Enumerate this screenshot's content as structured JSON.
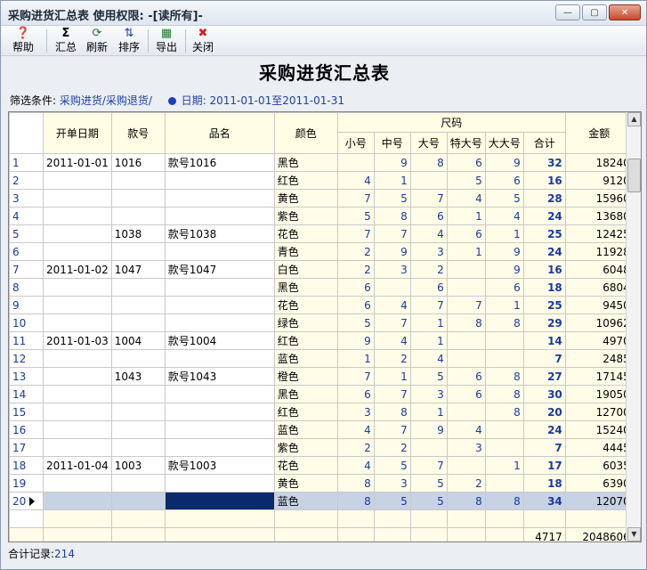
{
  "window": {
    "title": "采购进货汇总表  使用权限: -[读所有]-",
    "controls": {
      "minimize": "—",
      "restore": "▢",
      "close": "✕"
    }
  },
  "toolbar": {
    "items": [
      {
        "label": "帮助",
        "icon": "help-icon",
        "glyph": "❓"
      },
      {
        "label": "汇总",
        "icon": "sigma-icon",
        "glyph": "Σ"
      },
      {
        "label": "刷新",
        "icon": "refresh-icon",
        "glyph": "⟳"
      },
      {
        "label": "排序",
        "icon": "sort-icon",
        "glyph": "⇅"
      },
      {
        "label": "导出",
        "icon": "excel-export-icon",
        "glyph": "▦"
      },
      {
        "label": "关闭",
        "icon": "close-red-icon",
        "glyph": "✖"
      }
    ]
  },
  "report": {
    "title": "采购进货汇总表"
  },
  "filter": {
    "label": "筛选条件:",
    "value": "采购进货/采购退货/",
    "date_label": "日期:",
    "date_value": "2011-01-01至2011-01-31"
  },
  "grid": {
    "headers": {
      "order_date": "开单日期",
      "style_no": "款号",
      "product_name": "品名",
      "color": "颜色",
      "size_group": "尺码",
      "sizes": [
        "小号",
        "中号",
        "大号",
        "特大号",
        "大大号",
        "合计"
      ],
      "amount": "金额"
    },
    "rows": [
      {
        "n": "1",
        "date": "2011-01-01",
        "style": "1016",
        "name": "款号1016",
        "color": "黑色",
        "s": "",
        "m": "9",
        "l": "8",
        "xl": "6",
        "xxl": "9",
        "total": "32",
        "amount": "18240"
      },
      {
        "n": "2",
        "date": "",
        "style": "",
        "name": "",
        "color": "红色",
        "s": "4",
        "m": "1",
        "l": "",
        "xl": "5",
        "xxl": "6",
        "total": "16",
        "amount": "9120"
      },
      {
        "n": "3",
        "date": "",
        "style": "",
        "name": "",
        "color": "黄色",
        "s": "7",
        "m": "5",
        "l": "7",
        "xl": "4",
        "xxl": "5",
        "total": "28",
        "amount": "15960"
      },
      {
        "n": "4",
        "date": "",
        "style": "",
        "name": "",
        "color": "紫色",
        "s": "5",
        "m": "8",
        "l": "6",
        "xl": "1",
        "xxl": "4",
        "total": "24",
        "amount": "13680"
      },
      {
        "n": "5",
        "date": "",
        "style": "1038",
        "name": "款号1038",
        "color": "花色",
        "s": "7",
        "m": "7",
        "l": "4",
        "xl": "6",
        "xxl": "1",
        "total": "25",
        "amount": "12425"
      },
      {
        "n": "6",
        "date": "",
        "style": "",
        "name": "",
        "color": "青色",
        "s": "2",
        "m": "9",
        "l": "3",
        "xl": "1",
        "xxl": "9",
        "total": "24",
        "amount": "11928"
      },
      {
        "n": "7",
        "date": "2011-01-02",
        "style": "1047",
        "name": "款号1047",
        "color": "白色",
        "s": "2",
        "m": "3",
        "l": "2",
        "xl": "",
        "xxl": "9",
        "total": "16",
        "amount": "6048"
      },
      {
        "n": "8",
        "date": "",
        "style": "",
        "name": "",
        "color": "黑色",
        "s": "6",
        "m": "",
        "l": "6",
        "xl": "",
        "xxl": "6",
        "total": "18",
        "amount": "6804"
      },
      {
        "n": "9",
        "date": "",
        "style": "",
        "name": "",
        "color": "花色",
        "s": "6",
        "m": "4",
        "l": "7",
        "xl": "7",
        "xxl": "1",
        "total": "25",
        "amount": "9450"
      },
      {
        "n": "10",
        "date": "",
        "style": "",
        "name": "",
        "color": "绿色",
        "s": "5",
        "m": "7",
        "l": "1",
        "xl": "8",
        "xxl": "8",
        "total": "29",
        "amount": "10962"
      },
      {
        "n": "11",
        "date": "2011-01-03",
        "style": "1004",
        "name": "款号1004",
        "color": "红色",
        "s": "9",
        "m": "4",
        "l": "1",
        "xl": "",
        "xxl": "",
        "total": "14",
        "amount": "4970"
      },
      {
        "n": "12",
        "date": "",
        "style": "",
        "name": "",
        "color": "蓝色",
        "s": "1",
        "m": "2",
        "l": "4",
        "xl": "",
        "xxl": "",
        "total": "7",
        "amount": "2485"
      },
      {
        "n": "13",
        "date": "",
        "style": "1043",
        "name": "款号1043",
        "color": "橙色",
        "s": "7",
        "m": "1",
        "l": "5",
        "xl": "6",
        "xxl": "8",
        "total": "27",
        "amount": "17145"
      },
      {
        "n": "14",
        "date": "",
        "style": "",
        "name": "",
        "color": "黑色",
        "s": "6",
        "m": "7",
        "l": "3",
        "xl": "6",
        "xxl": "8",
        "total": "30",
        "amount": "19050"
      },
      {
        "n": "15",
        "date": "",
        "style": "",
        "name": "",
        "color": "红色",
        "s": "3",
        "m": "8",
        "l": "1",
        "xl": "",
        "xxl": "8",
        "total": "20",
        "amount": "12700"
      },
      {
        "n": "16",
        "date": "",
        "style": "",
        "name": "",
        "color": "蓝色",
        "s": "4",
        "m": "7",
        "l": "9",
        "xl": "4",
        "xxl": "",
        "total": "24",
        "amount": "15240"
      },
      {
        "n": "17",
        "date": "",
        "style": "",
        "name": "",
        "color": "紫色",
        "s": "2",
        "m": "2",
        "l": "",
        "xl": "3",
        "xxl": "",
        "total": "7",
        "amount": "4445"
      },
      {
        "n": "18",
        "date": "2011-01-04",
        "style": "1003",
        "name": "款号1003",
        "color": "花色",
        "s": "4",
        "m": "5",
        "l": "7",
        "xl": "",
        "xxl": "1",
        "total": "17",
        "amount": "6035"
      },
      {
        "n": "19",
        "date": "",
        "style": "",
        "name": "",
        "color": "黄色",
        "s": "8",
        "m": "3",
        "l": "5",
        "xl": "2",
        "xxl": "",
        "total": "18",
        "amount": "6390"
      },
      {
        "n": "20",
        "date": "",
        "style": "",
        "name": "",
        "color": "蓝色",
        "s": "8",
        "m": "5",
        "l": "5",
        "xl": "8",
        "xxl": "8",
        "total": "34",
        "amount": "12070",
        "selected": true
      }
    ],
    "footer": {
      "total": "4717",
      "amount": "2048606"
    }
  },
  "status": {
    "label": "合计记录:",
    "value": "214"
  },
  "colors": {
    "header_bg": "#fffde3",
    "cell_bg": "#fffde8",
    "number_blue": "#1a3aa0",
    "selection": "#c7d3e4",
    "cursor": "#0b2a6b"
  }
}
